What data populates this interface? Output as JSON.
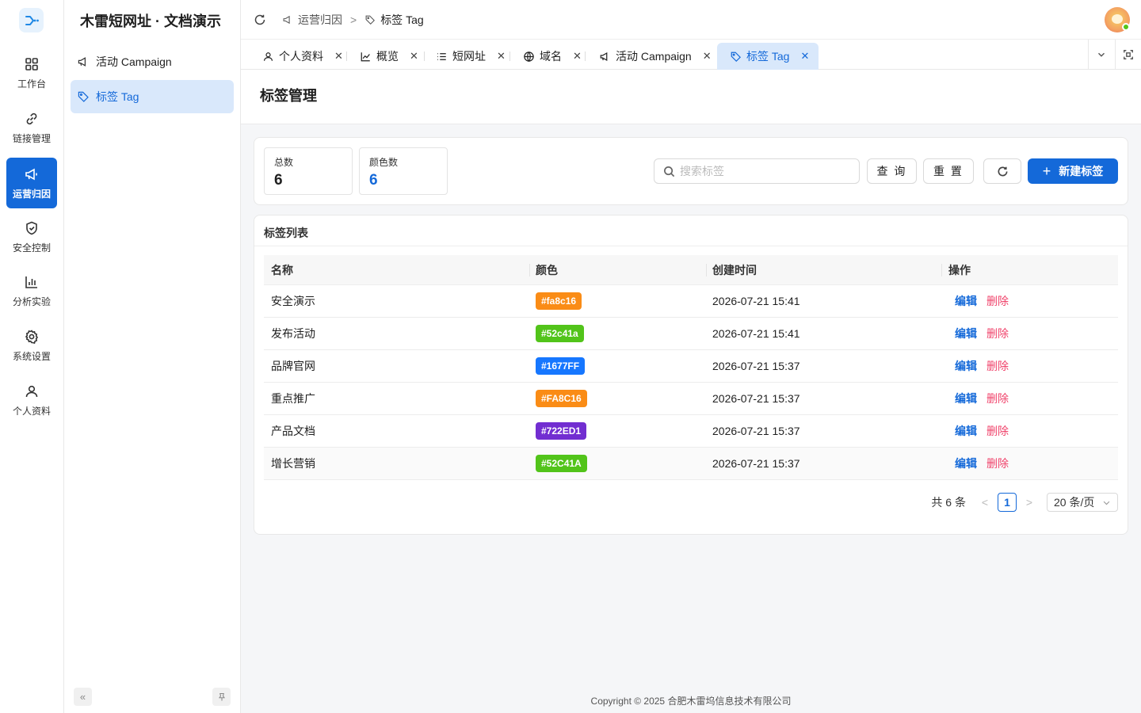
{
  "app": {
    "title": "木雷短网址 · 文档演示"
  },
  "rail": {
    "items": [
      {
        "label": "工作台",
        "icon": "dashboard-icon"
      },
      {
        "label": "链接管理",
        "icon": "link-icon"
      },
      {
        "label": "运营归因",
        "icon": "megaphone-icon",
        "active": true
      },
      {
        "label": "安全控制",
        "icon": "shield-icon"
      },
      {
        "label": "分析实验",
        "icon": "bar-chart-icon"
      },
      {
        "label": "系统设置",
        "icon": "gear-icon"
      },
      {
        "label": "个人资料",
        "icon": "user-icon"
      }
    ]
  },
  "sidebar": {
    "items": [
      {
        "label": "活动 Campaign",
        "icon": "megaphone-icon"
      },
      {
        "label": "标签 Tag",
        "icon": "tag-icon",
        "active": true
      }
    ]
  },
  "header": {
    "breadcrumb": [
      "运营归因",
      "标签 Tag"
    ],
    "breadcrumb_separator": ">"
  },
  "tabs": [
    {
      "label": "个人资料",
      "icon": "user-icon"
    },
    {
      "label": "概览",
      "icon": "line-chart-icon"
    },
    {
      "label": "短网址",
      "icon": "list-icon"
    },
    {
      "label": "域名",
      "icon": "globe-icon"
    },
    {
      "label": "活动 Campaign",
      "icon": "megaphone-icon"
    },
    {
      "label": "标签 Tag",
      "icon": "tag-icon",
      "active": true
    }
  ],
  "page": {
    "title": "标签管理"
  },
  "stats": [
    {
      "label": "总数",
      "value": "6"
    },
    {
      "label": "颜色数",
      "value": "6"
    }
  ],
  "toolbar": {
    "search_placeholder": "搜索标签",
    "search_value": "",
    "query_label": "查 询",
    "reset_label": "重 置",
    "create_label": "新建标签"
  },
  "table": {
    "title": "标签列表",
    "columns": [
      "名称",
      "颜色",
      "创建时间",
      "操作"
    ],
    "rows": [
      {
        "name": "安全演示",
        "color": "#fa8c16",
        "created": "2026-07-21 15:41"
      },
      {
        "name": "发布活动",
        "color": "#52c41a",
        "created": "2026-07-21 15:41"
      },
      {
        "name": "品牌官网",
        "color": "#1677FF",
        "created": "2026-07-21 15:37"
      },
      {
        "name": "重点推广",
        "color": "#FA8C16",
        "created": "2026-07-21 15:37"
      },
      {
        "name": "产品文档",
        "color": "#722ED1",
        "created": "2026-07-21 15:37"
      },
      {
        "name": "增长营销",
        "color": "#52C41A",
        "created": "2026-07-21 15:37"
      }
    ],
    "actions": {
      "edit": "编辑",
      "delete": "删除"
    }
  },
  "pagination": {
    "total_text": "共 6 条",
    "current_page": "1",
    "page_size": "20 条/页",
    "prev": "<",
    "next": ">"
  },
  "colors": {
    "primary": "#1469d9",
    "danger": "#f0436b",
    "active_bg": "#d9e8fb"
  },
  "footer": {
    "copyright": "Copyright © 2025 合肥木雷坞信息技术有限公司"
  }
}
